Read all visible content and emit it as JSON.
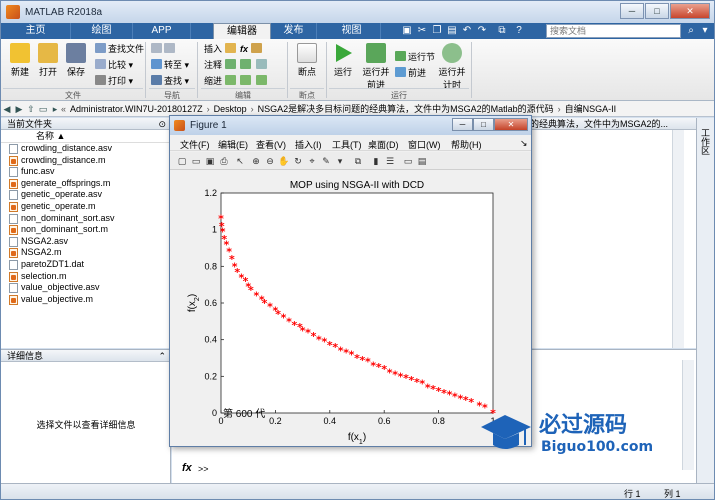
{
  "window": {
    "title": "MATLAB R2018a",
    "minimize": "─",
    "maximize": "□",
    "close": "✕"
  },
  "tabs": [
    "主页",
    "绘图",
    "APP",
    "编辑器",
    "发布",
    "视图"
  ],
  "search": {
    "placeholder": "搜索文档"
  },
  "ribbon": {
    "file_group": {
      "label": "文件",
      "new": "新建",
      "open": "打开",
      "save": "保存",
      "find_files": "查找文件",
      "compare": "比较",
      "print": "打印"
    },
    "navigate_group": {
      "label": "导航",
      "goto": "转至",
      "find": "查找"
    },
    "edit_group": {
      "label": "编辑",
      "insert": "插入",
      "comment": "注释",
      "indent": "缩进",
      "fx": "fx"
    },
    "breakpoints_group": {
      "label": "断点",
      "breakpoints": "断点"
    },
    "run_group": {
      "label": "运行",
      "run": "运行",
      "run_advance": "运行并前进",
      "run_section": "运行节",
      "advance": "前进",
      "run_time": "运行并计时"
    }
  },
  "address": {
    "crumbs": [
      "Administrator.WIN7U-20180127Z",
      "Desktop",
      "NSGA2是解决多目标问题的经典算法，文件中为MSGA2的Matlab的源代码",
      "自编NSGA-II"
    ]
  },
  "current_folder": {
    "header": "当前文件夹",
    "column_name": "名称 ▲",
    "files": [
      {
        "name": "crowding_distance.asv",
        "type": "asv"
      },
      {
        "name": "crowding_distance.m",
        "type": "m"
      },
      {
        "name": "func.asv",
        "type": "asv"
      },
      {
        "name": "generate_offsprings.m",
        "type": "m"
      },
      {
        "name": "genetic_operate.asv",
        "type": "asv"
      },
      {
        "name": "genetic_operate.m",
        "type": "m"
      },
      {
        "name": "non_dominant_sort.asv",
        "type": "asv"
      },
      {
        "name": "non_dominant_sort.m",
        "type": "m"
      },
      {
        "name": "NSGA2.asv",
        "type": "asv"
      },
      {
        "name": "NSGA2.m",
        "type": "m"
      },
      {
        "name": "paretoZDT1.dat",
        "type": "dat"
      },
      {
        "name": "selection.m",
        "type": "m"
      },
      {
        "name": "value_objective.asv",
        "type": "asv"
      },
      {
        "name": "value_objective.m",
        "type": "m"
      }
    ]
  },
  "details": {
    "header": "详细信息",
    "empty_text": "选择文件以查看详细信息"
  },
  "behind_editor": {
    "tab_text": "的经典算法，文件中为MSGA2的..."
  },
  "workspace": {
    "label": "工作区"
  },
  "command_window": {
    "prompt": "fx",
    "arrows": ">>"
  },
  "status": {
    "row": "行 1",
    "col": "列 1"
  },
  "figure": {
    "title": "Figure 1",
    "menus": [
      "文件(F)",
      "编辑(E)",
      "查看(V)",
      "插入(I)",
      "工具(T)",
      "桌面(D)",
      "窗口(W)",
      "帮助(H)"
    ]
  },
  "chart_data": {
    "type": "scatter",
    "title": "MOP using NSGA-II with DCD",
    "xlabel": "f(x1)",
    "ylabel": "f(x2)",
    "annotation": "第 600 代",
    "xlim": [
      0,
      1
    ],
    "ylim": [
      0,
      1.2
    ],
    "xticks": [
      0,
      0.2,
      0.4,
      0.6,
      0.8,
      1
    ],
    "yticks": [
      0,
      0.2,
      0.4,
      0.6,
      0.8,
      1,
      1.2
    ],
    "marker_color": "#ff0000",
    "marker": "*",
    "grid": false,
    "x": [
      0.0,
      0.003,
      0.006,
      0.012,
      0.02,
      0.03,
      0.04,
      0.05,
      0.06,
      0.075,
      0.09,
      0.1,
      0.11,
      0.13,
      0.15,
      0.16,
      0.18,
      0.2,
      0.21,
      0.23,
      0.25,
      0.27,
      0.29,
      0.3,
      0.32,
      0.34,
      0.36,
      0.38,
      0.4,
      0.42,
      0.44,
      0.46,
      0.48,
      0.5,
      0.52,
      0.54,
      0.56,
      0.58,
      0.6,
      0.62,
      0.64,
      0.66,
      0.68,
      0.7,
      0.72,
      0.74,
      0.76,
      0.78,
      0.8,
      0.82,
      0.84,
      0.86,
      0.88,
      0.9,
      0.92,
      0.95,
      0.97,
      1.0
    ],
    "y": [
      1.06,
      1.02,
      0.99,
      0.95,
      0.92,
      0.88,
      0.84,
      0.8,
      0.77,
      0.74,
      0.72,
      0.69,
      0.67,
      0.64,
      0.62,
      0.6,
      0.58,
      0.56,
      0.54,
      0.52,
      0.5,
      0.48,
      0.47,
      0.45,
      0.44,
      0.42,
      0.4,
      0.39,
      0.37,
      0.36,
      0.34,
      0.33,
      0.32,
      0.3,
      0.29,
      0.28,
      0.26,
      0.25,
      0.24,
      0.22,
      0.21,
      0.2,
      0.19,
      0.18,
      0.17,
      0.16,
      0.14,
      0.13,
      0.12,
      0.11,
      0.1,
      0.09,
      0.08,
      0.07,
      0.06,
      0.04,
      0.03,
      0.0
    ]
  },
  "watermark": {
    "brand": "必过源码",
    "url": "Biguo100.com"
  }
}
